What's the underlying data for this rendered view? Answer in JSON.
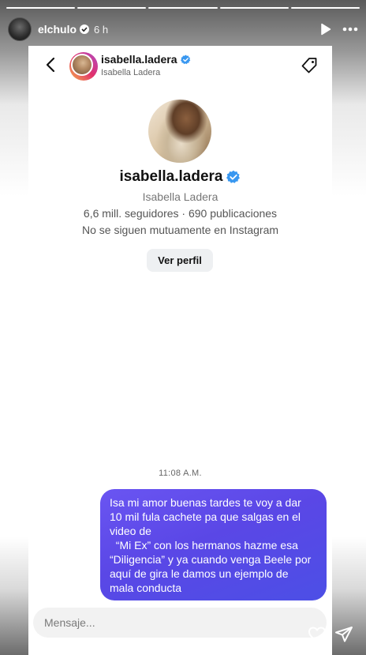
{
  "story": {
    "username": "elchulo",
    "time": "6 h",
    "progress_segments": 5,
    "progress_done": 5
  },
  "dm": {
    "username": "isabella.ladera",
    "subtitle": "Isabella Ladera"
  },
  "profile": {
    "username": "isabella.ladera",
    "full_name": "Isabella Ladera",
    "stats": "6,6 mill. seguidores · 690 publicaciones",
    "mutual": "No se siguen mutuamente en Instagram",
    "view_profile_label": "Ver perfil"
  },
  "message": {
    "time": "11:08 A.M.",
    "lines": [
      "Isa mi amor buenas tardes te voy a dar",
      "10 mil fula cachete pa que salgas en el",
      "video de",
      "  “Mi Ex” con los hermanos hazme esa",
      "“Diligencia” y ya cuando venga Beele por",
      "aquí de gira le damos un ejemplo de",
      "mala conducta"
    ]
  },
  "composer": {
    "placeholder": "Mensaje..."
  },
  "colors": {
    "bubble": "#5a47e6",
    "verified": "#3897f0"
  },
  "icons": [
    "play-icon",
    "more-icon",
    "back-icon",
    "tag-icon",
    "verified-icon",
    "heart-icon",
    "send-icon"
  ]
}
